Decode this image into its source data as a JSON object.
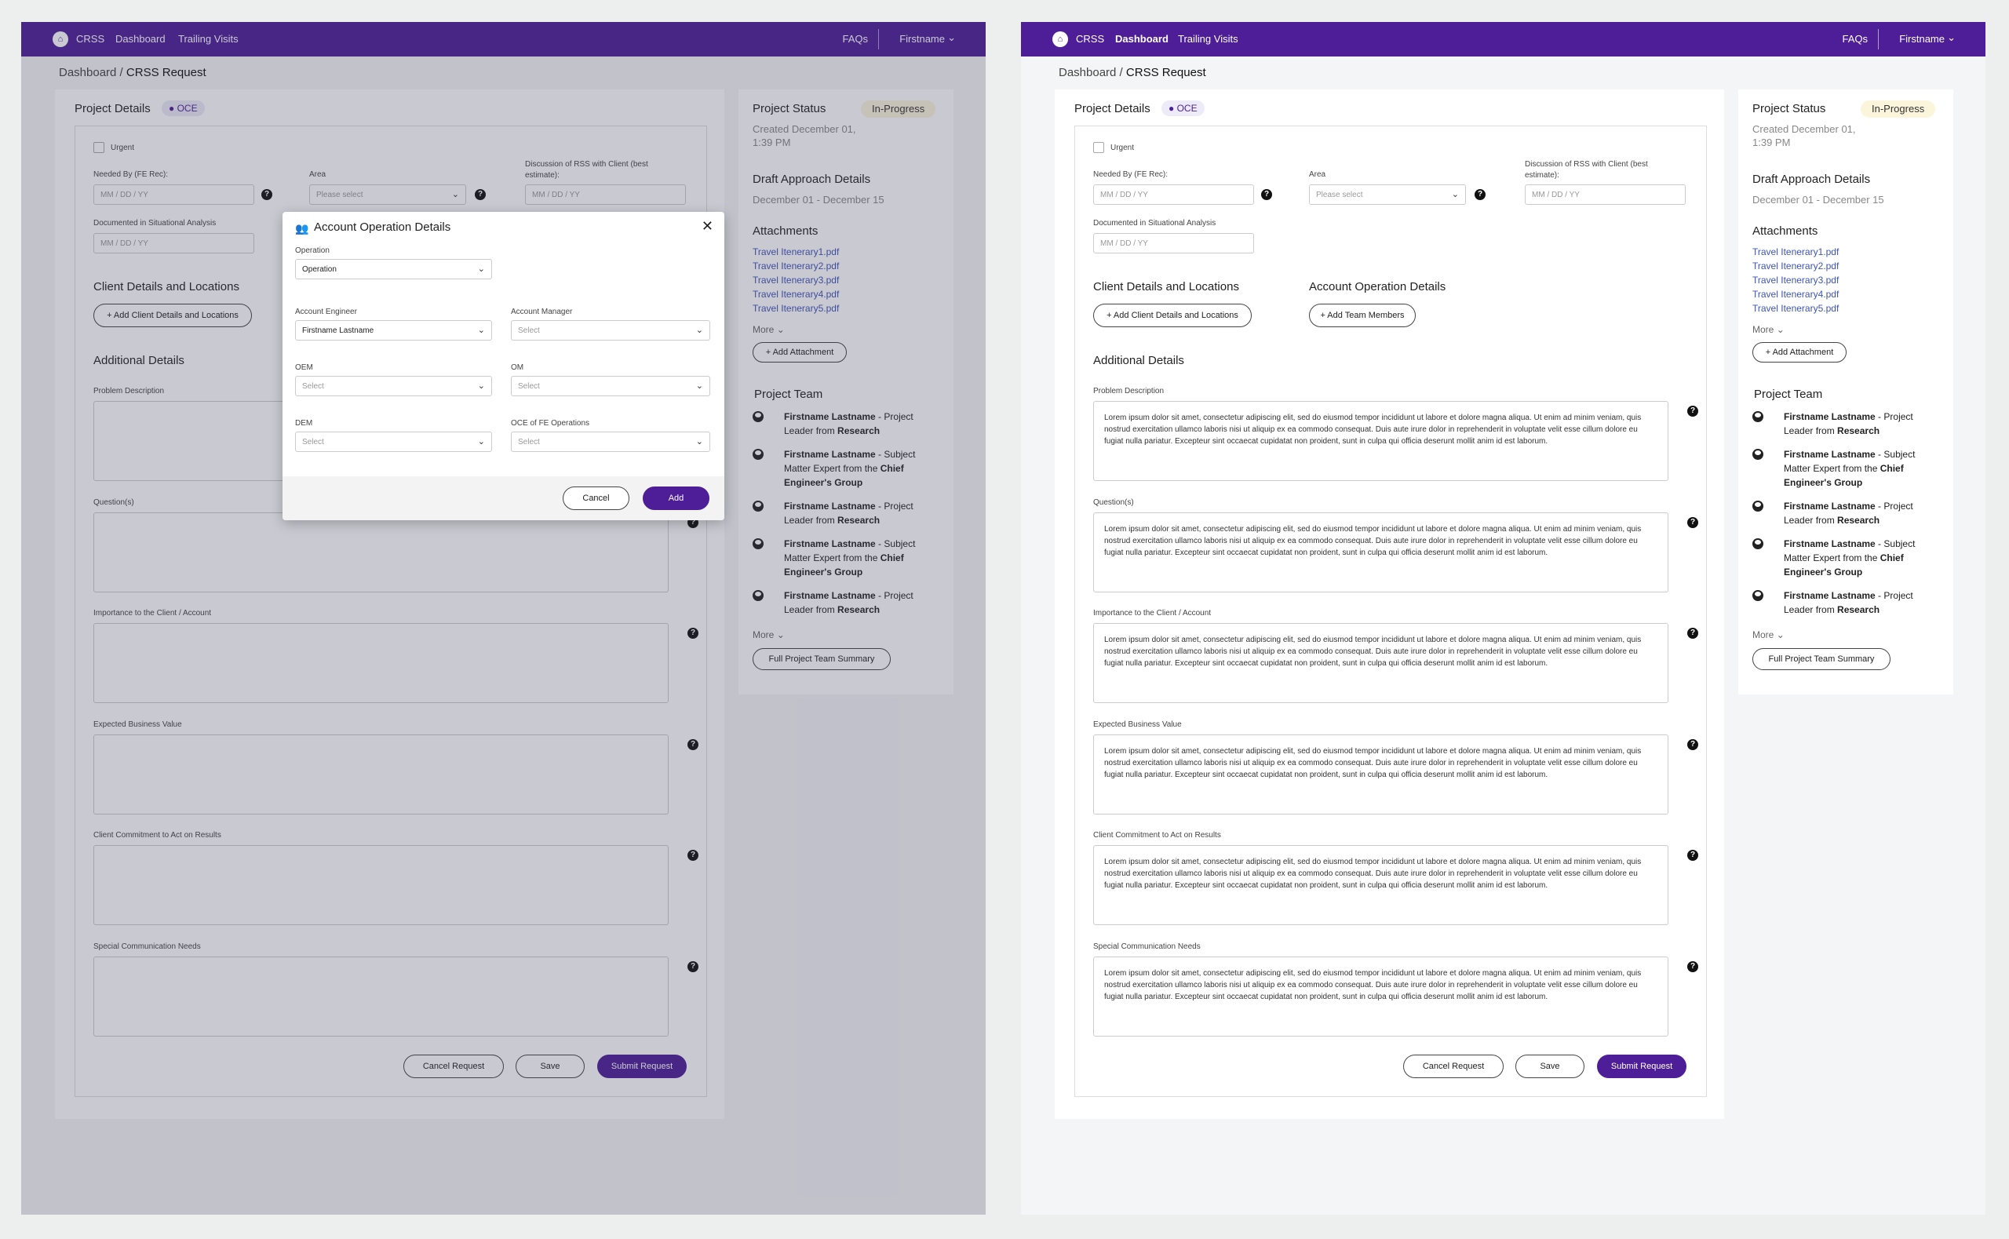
{
  "app": {
    "name": "CRSS",
    "logo": "home-icon"
  },
  "nav": {
    "dashboard": "Dashboard",
    "trailing_visits": "Trailing Visits",
    "faqs": "FAQs",
    "user": "Firstname"
  },
  "breadcrumb": {
    "root": "Dashboard",
    "sep": " / ",
    "current": "CRSS Request"
  },
  "project_details": {
    "title": "Project Details",
    "badge": "OCE",
    "urgent_label": "Urgent",
    "needed_by_label": "Needed By (FE Rec):",
    "area_label": "Area",
    "discussion_label_1": "Discussion of RSS with Client (best",
    "discussion_label_2": "estimate):",
    "documented_label": "Documented in Situational Analysis",
    "date_placeholder": "MM / DD / YY",
    "area_placeholder": "Please select"
  },
  "client_details": {
    "title": "Client Details and Locations",
    "add_button": "+ Add Client Details and Locations"
  },
  "account_operation": {
    "title": "Account Operation Details",
    "add_button": "+ Add Team Members"
  },
  "additional": {
    "title": "Additional Details",
    "fields": [
      {
        "label": "Problem Description"
      },
      {
        "label": "Question(s)"
      },
      {
        "label": "Importance to the Client / Account"
      },
      {
        "label": "Expected Business Value"
      },
      {
        "label": "Client Commitment to Act on Results"
      },
      {
        "label": "Special Communication Needs"
      }
    ],
    "lorem": "Lorem ipsum dolor sit amet, consectetur adipiscing elit, sed do eiusmod tempor incididunt ut labore et dolore magna aliqua. Ut enim ad minim veniam, quis nostrud exercitation ullamco laboris nisi ut aliquip ex ea commodo consequat. Duis aute irure dolor in reprehenderit in voluptate velit esse cillum dolore eu fugiat nulla pariatur. Excepteur sint occaecat cupidatat non proident, sunt in culpa qui officia deserunt mollit anim id est laborum."
  },
  "actions": {
    "cancel": "Cancel Request",
    "save": "Save",
    "submit": "Submit Request"
  },
  "status": {
    "title": "Project Status",
    "badge": "In-Progress",
    "created_1": "Created December 01,",
    "created_2": "1:39 PM",
    "draft_title": "Draft Approach Details",
    "draft_dates": "December 01 - December 15",
    "attachments_title": "Attachments",
    "attachments": [
      "Travel Itenerary1.pdf",
      "Travel Itenerary2.pdf",
      "Travel Itenerary3.pdf",
      "Travel Itenerary4.pdf",
      "Travel Itenerary5.pdf"
    ],
    "more": "More",
    "add_attachment": "+ Add Attachment",
    "team_title": "Project Team",
    "team": [
      {
        "name": "Firstname Lastname",
        "sep": " - ",
        "role": "Project Leader from ",
        "org": "Research"
      },
      {
        "name": "Firstname Lastname",
        "sep": " - ",
        "role": "Subject Matter Expert from the ",
        "org": "Chief Engineer's Group"
      },
      {
        "name": "Firstname Lastname",
        "sep": " - ",
        "role": "Project Leader from ",
        "org": "Research"
      },
      {
        "name": "Firstname Lastname",
        "sep": " - ",
        "role": "Subject Matter Expert from the ",
        "org": "Chief Engineer's Group"
      },
      {
        "name": "Firstname Lastname",
        "sep": " - ",
        "role": "Project Leader from ",
        "org": "Research"
      }
    ],
    "team_more": "More",
    "full_summary": "Full Project Team Summary"
  },
  "modal": {
    "title": "Account Operation Details",
    "icon": "users-icon",
    "operation_label": "Operation",
    "operation_value": "Operation",
    "account_engineer_label": "Account Engineer",
    "account_engineer_value": "Firstname Lastname",
    "account_manager_label": "Account Manager",
    "oem_label": "OEM",
    "om_label": "OM",
    "dem_label": "DEM",
    "oce_label": "OCE of FE Operations",
    "select_placeholder": "Select",
    "cancel": "Cancel",
    "add": "Add"
  },
  "colors": {
    "brand": "#4d1e98",
    "link": "#3e54b8",
    "status_badge": "#fbf5dc"
  }
}
